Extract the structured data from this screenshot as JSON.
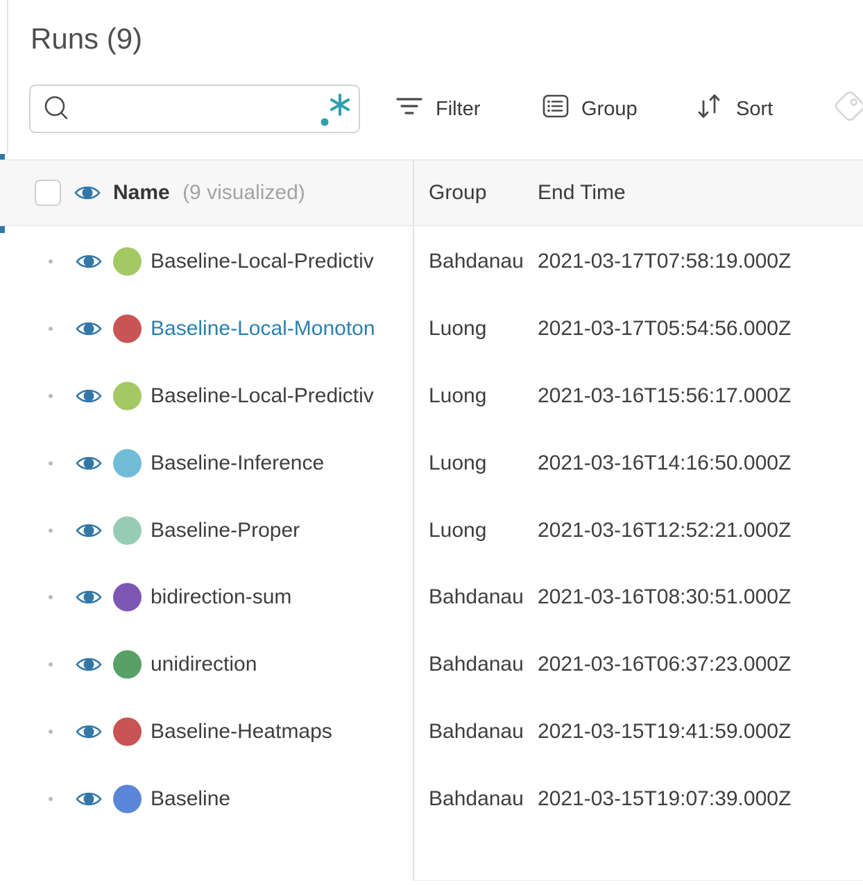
{
  "colors": {
    "accent_blue": "#3377a6",
    "eye_blue": "#3377a6",
    "link_blue": "#2e7fae",
    "regex_teal": "#2e9fad",
    "header_bg": "#f7f7f7"
  },
  "panel": {
    "title": "Runs (9)",
    "search": {
      "value": "",
      "placeholder": "",
      "regex_label": ".*"
    },
    "toolbar": {
      "filter": "Filter",
      "group": "Group",
      "sort": "Sort"
    }
  },
  "table": {
    "header": {
      "name": "Name",
      "visualized": "(9 visualized)",
      "group": "Group",
      "end_time": "End Time"
    },
    "rows": [
      {
        "name": "Baseline-Local-Predictiv",
        "color": "#a3c964",
        "link": false,
        "group": "Bahdanau",
        "end_time": "2021-03-17T07:58:19.000Z"
      },
      {
        "name": "Baseline-Local-Monoton",
        "color": "#c85454",
        "link": true,
        "group": "Luong",
        "end_time": "2021-03-17T05:54:56.000Z"
      },
      {
        "name": "Baseline-Local-Predictiv",
        "color": "#a3c964",
        "link": false,
        "group": "Luong",
        "end_time": "2021-03-16T15:56:17.000Z"
      },
      {
        "name": "Baseline-Inference",
        "color": "#6fbdd8",
        "link": false,
        "group": "Luong",
        "end_time": "2021-03-16T14:16:50.000Z"
      },
      {
        "name": "Baseline-Proper",
        "color": "#95ccb3",
        "link": false,
        "group": "Luong",
        "end_time": "2021-03-16T12:52:21.000Z"
      },
      {
        "name": "bidirection-sum",
        "color": "#7e57b4",
        "link": false,
        "group": "Bahdanau",
        "end_time": "2021-03-16T08:30:51.000Z"
      },
      {
        "name": "unidirection",
        "color": "#57a066",
        "link": false,
        "group": "Bahdanau",
        "end_time": "2021-03-16T06:37:23.000Z"
      },
      {
        "name": "Baseline-Heatmaps",
        "color": "#c85454",
        "link": false,
        "group": "Bahdanau",
        "end_time": "2021-03-15T19:41:59.000Z"
      },
      {
        "name": "Baseline",
        "color": "#5b85d8",
        "link": false,
        "group": "Bahdanau",
        "end_time": "2021-03-15T19:07:39.000Z"
      }
    ]
  }
}
